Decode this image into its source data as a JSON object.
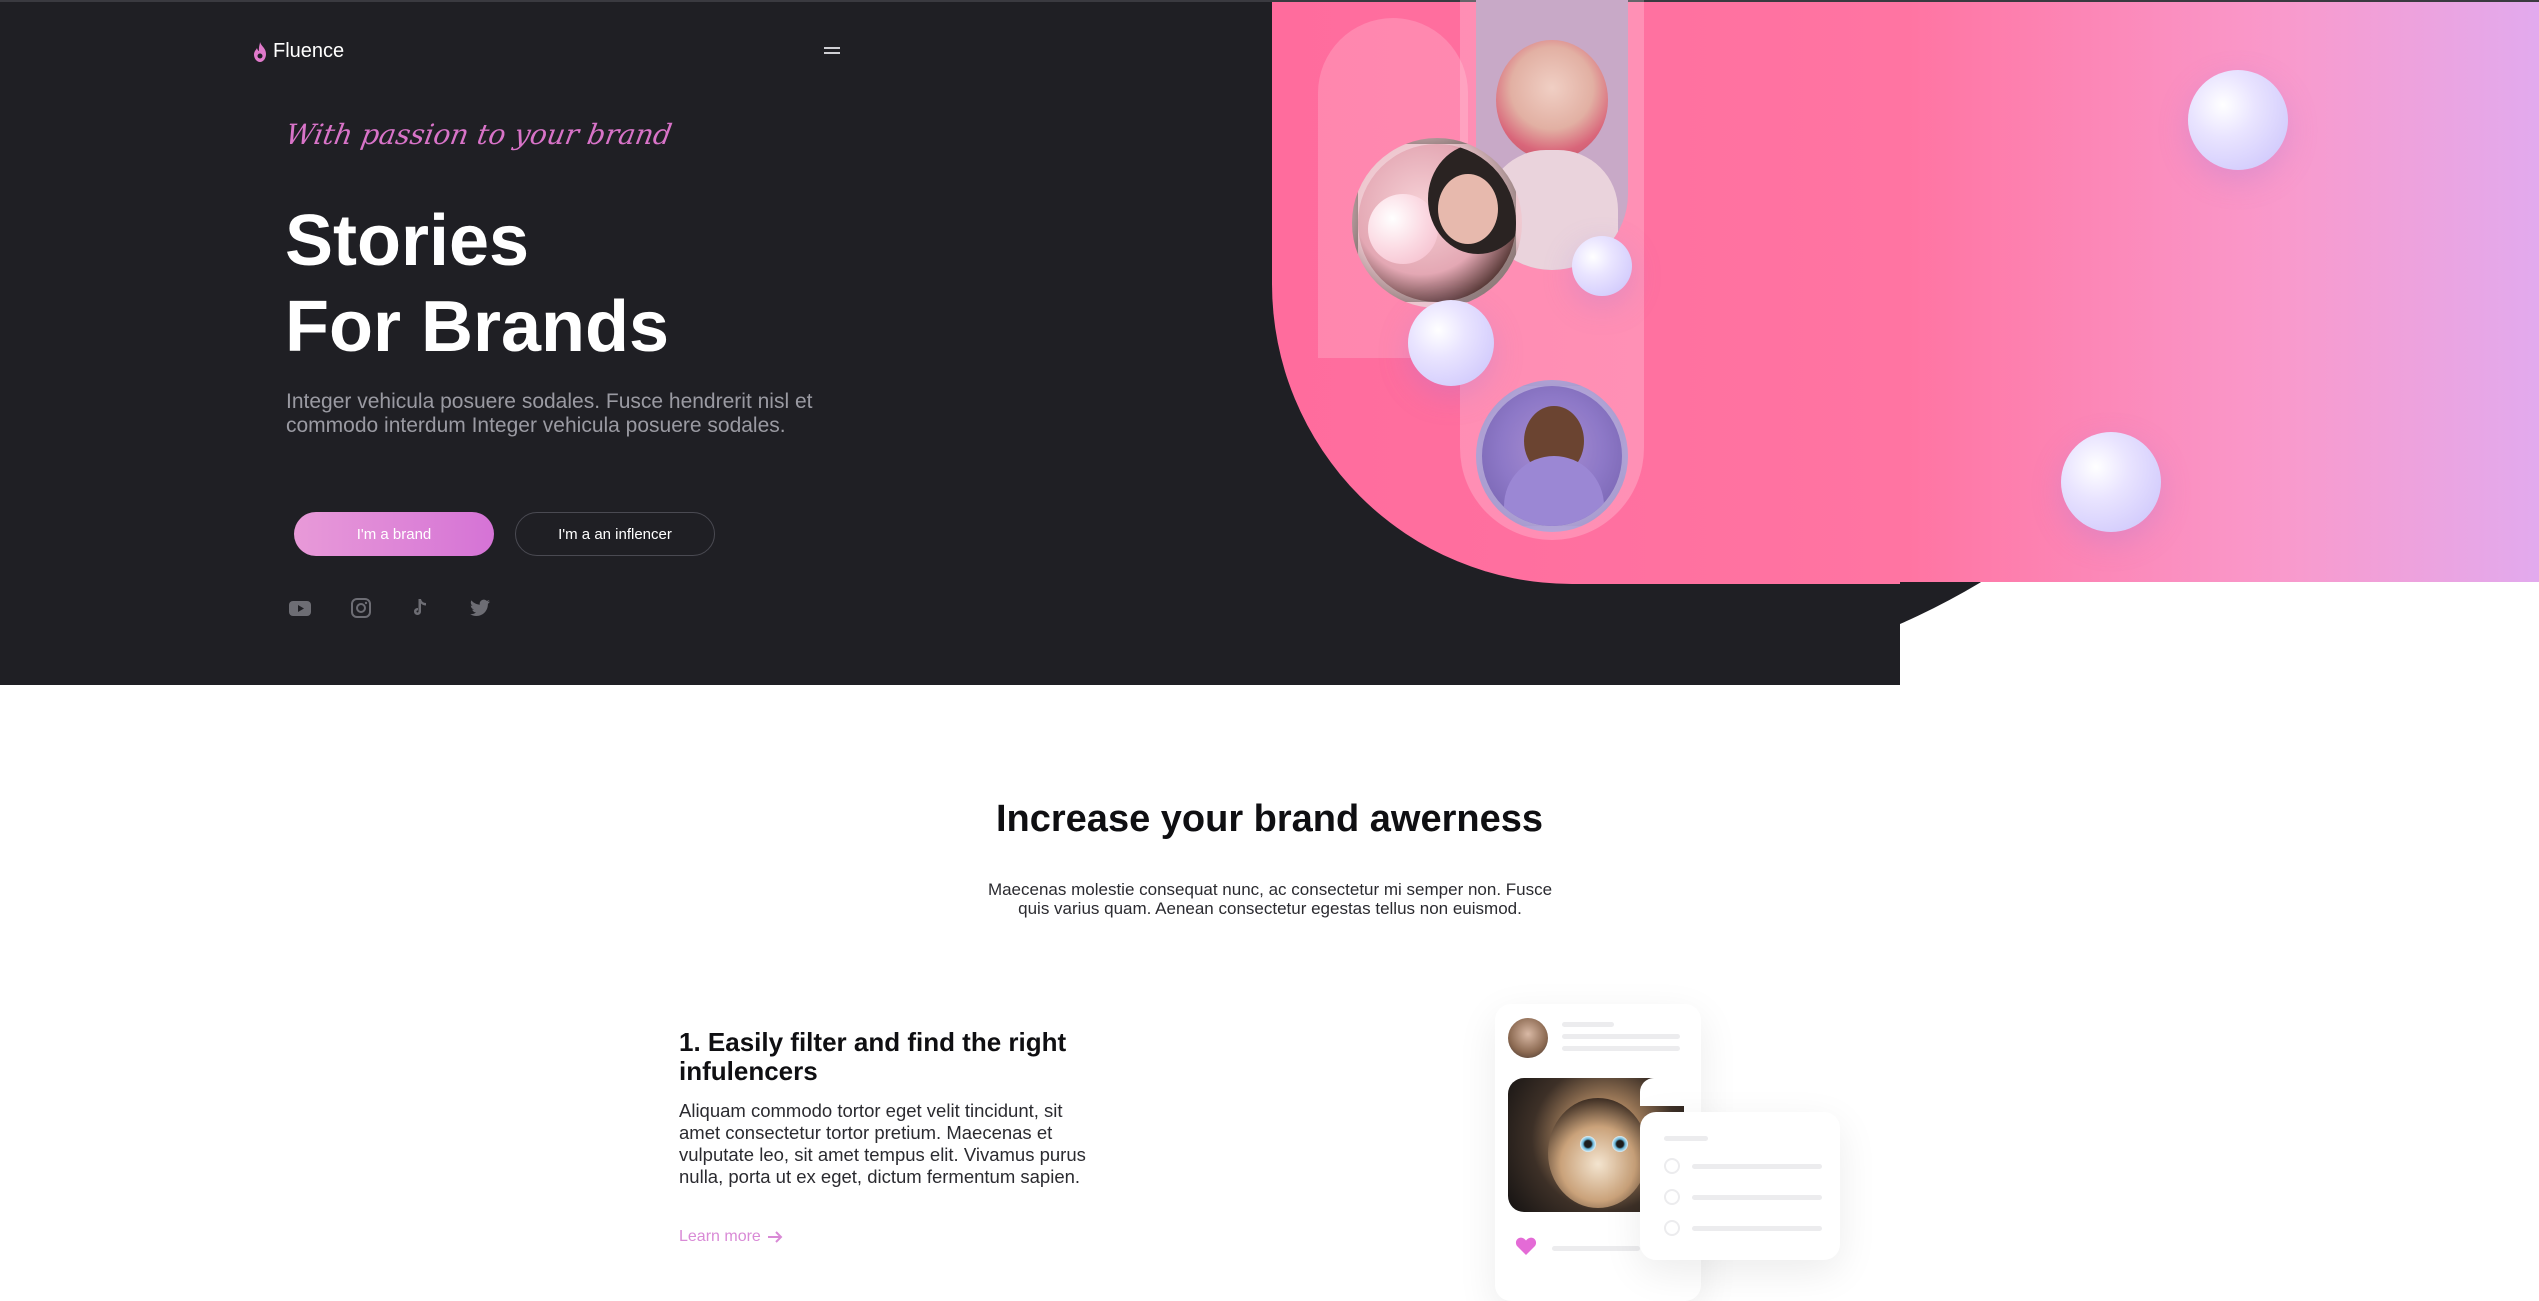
{
  "nav": {
    "brand": "Fluence",
    "menu_icon": "hamburger-menu-icon",
    "logo_icon": "flame-icon"
  },
  "hero": {
    "tagline": "With passion to your brand",
    "title_line1": "Stories",
    "title_line2": "For Brands",
    "lead": "Integer vehicula posuere sodales. Fusce hendrerit nisl et commodo interdum Integer vehicula posuere sodales.",
    "brand_button": "I'm a brand",
    "influencer_button": "I'm a an inflencer",
    "socials": [
      "youtube-icon",
      "instagram-icon",
      "tiktok-icon",
      "twitter-icon"
    ]
  },
  "awareness": {
    "title": "Increase your brand awerness",
    "subtitle": "Maecenas molestie consequat nunc, ac consectetur mi semper non. Fusce quis varius quam. Aenean consectetur egestas tellus non euismod."
  },
  "feature": {
    "title": "1. Easily filter and find the right infulencers",
    "body": "Aliquam commodo tortor eget velit tincidunt, sit amet consectetur tortor pretium. Maecenas et vulputate leo, sit amet tempus elit. Vivamus purus nulla, porta ut ex eget, dictum fermentum sapien.",
    "link": "Learn more",
    "link_icon": "arrow-right-icon"
  },
  "colors": {
    "dark_bg": "#1f1f24",
    "pink": "#ff6c9d",
    "lavender": "#e2aaee",
    "accent": "#d573d6"
  }
}
